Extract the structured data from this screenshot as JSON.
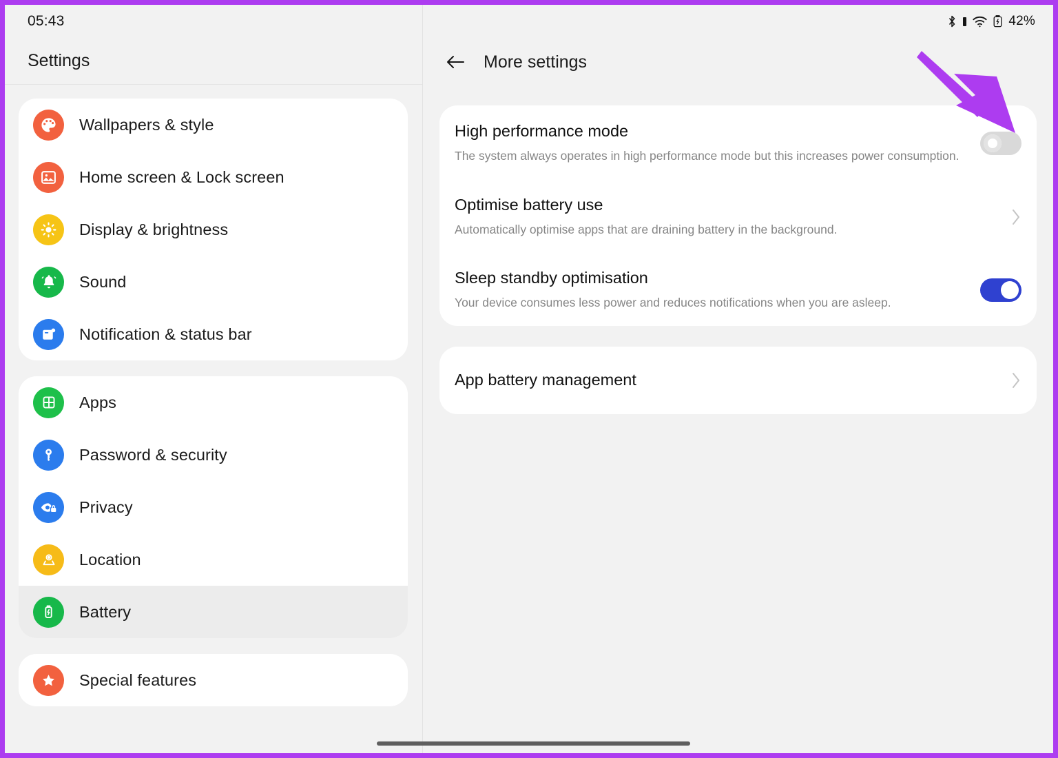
{
  "frame": {
    "accent_color": "#ad3cf0"
  },
  "status_bar": {
    "clock": "05:43",
    "battery_percent": "42%",
    "icons": [
      "bluetooth-icon",
      "signal-bar-icon",
      "wifi-icon",
      "battery-icon"
    ]
  },
  "sidebar": {
    "title": "Settings",
    "groups": [
      {
        "items": [
          {
            "label": "Wallpapers & style",
            "icon": "palette-icon",
            "color": "#f2613f",
            "selected": false
          },
          {
            "label": "Home screen & Lock screen",
            "icon": "image-icon",
            "color": "#f2613f",
            "selected": false
          },
          {
            "label": "Display & brightness",
            "icon": "sun-icon",
            "color": "#f6c416",
            "selected": false
          },
          {
            "label": "Sound",
            "icon": "bell-icon",
            "color": "#17b84a",
            "selected": false
          },
          {
            "label": "Notification & status bar",
            "icon": "notification-icon",
            "color": "#2b7ced",
            "selected": false
          }
        ]
      },
      {
        "items": [
          {
            "label": "Apps",
            "icon": "grid-icon",
            "color": "#1ec04a",
            "selected": false
          },
          {
            "label": "Password & security",
            "icon": "key-icon",
            "color": "#2b7ced",
            "selected": false
          },
          {
            "label": "Privacy",
            "icon": "eye-lock-icon",
            "color": "#2b7ced",
            "selected": false
          },
          {
            "label": "Location",
            "icon": "location-icon",
            "color": "#f6bb18",
            "selected": false
          },
          {
            "label": "Battery",
            "icon": "battery-icon",
            "color": "#17b84a",
            "selected": true
          }
        ]
      },
      {
        "items": [
          {
            "label": "Special features",
            "icon": "star-icon",
            "color": "#f2613f",
            "selected": false
          }
        ]
      }
    ]
  },
  "detail": {
    "back_label": "back-arrow",
    "title": "More settings",
    "cards": [
      {
        "rows": [
          {
            "title": "High performance mode",
            "desc": "The system always operates in high performance mode but this increases power consumption.",
            "control": "toggle",
            "toggle_state": "off"
          },
          {
            "title": "Optimise battery use",
            "desc": "Automatically optimise apps that are draining battery in the background.",
            "control": "chevron"
          },
          {
            "title": "Sleep standby optimisation",
            "desc": "Your device consumes less power and reduces notifications when you are asleep.",
            "control": "toggle",
            "toggle_state": "on"
          }
        ]
      },
      {
        "rows": [
          {
            "title": "App battery management",
            "desc": "",
            "control": "chevron"
          }
        ]
      }
    ]
  },
  "colors": {
    "toggle_on": "#2f41d0",
    "toggle_off": "#d9d9d9",
    "annotation": "#ad3cf0",
    "page_bg": "#f2f2f2",
    "card_bg": "#ffffff"
  }
}
